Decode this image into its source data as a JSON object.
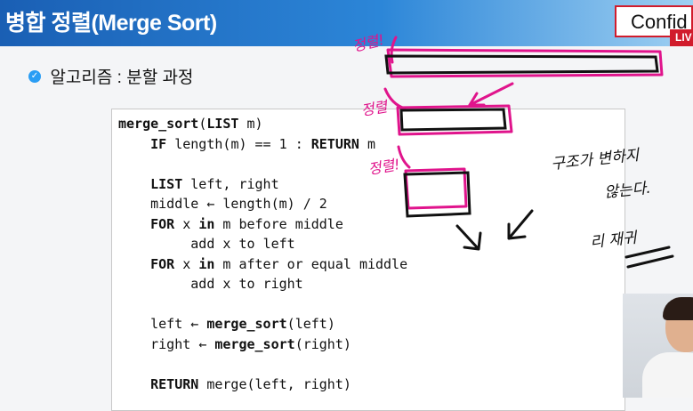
{
  "header": {
    "title": "병합 정렬(Merge Sort)",
    "logo_text": "Confid",
    "live_badge": "LIV"
  },
  "subtitle": "알고리즘 : 분할 과정",
  "code_lines": [
    "merge_sort(LIST m)",
    "    IF length(m) == 1 : RETURN m",
    "",
    "    LIST left, right",
    "    middle ← length(m) / 2",
    "    FOR x in m before middle",
    "         add x to left",
    "    FOR x in m after or equal middle",
    "         add x to right",
    "",
    "    left ← merge_sort(left)",
    "    right ← merge_sort(right)",
    "",
    "    RETURN merge(left, right)"
  ],
  "annotations": {
    "left_labels": [
      "정렬!",
      "정렬",
      "정렬!"
    ],
    "right_notes": [
      "구조가 변하지",
      "않는다.",
      "리 재귀"
    ]
  },
  "colors": {
    "header_start": "#1a5fb4",
    "header_end": "#9fd0f2",
    "ink_pink": "#e0148c",
    "ink_black": "#111111",
    "logo_border": "#d11c2c"
  }
}
